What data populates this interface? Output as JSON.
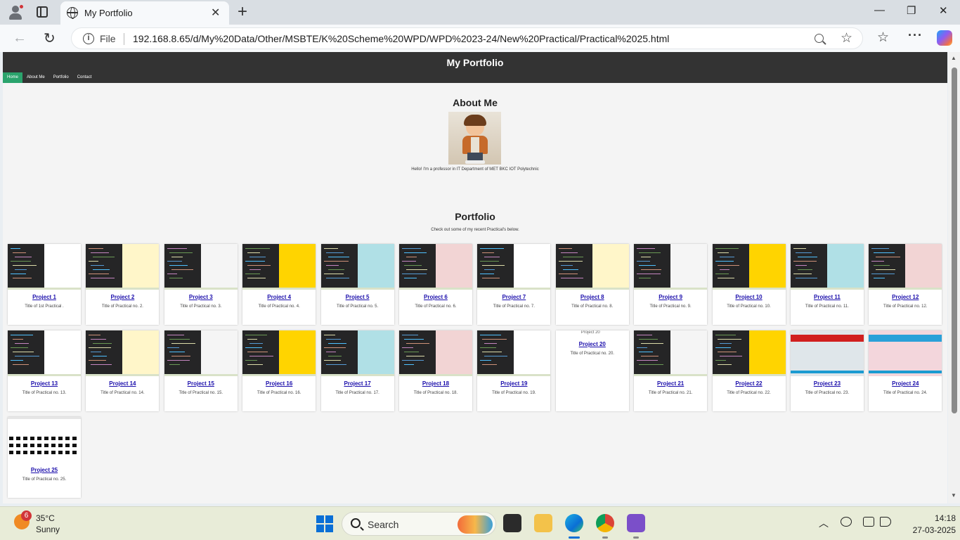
{
  "browser": {
    "tab_title": "My Portfolio",
    "file_label": "File",
    "url": "192.168.8.65/d/My%20Data/Other/MSBTE/K%20Scheme%20WPD/WPD%2023-24/New%20Practical/Practical%2025.html"
  },
  "page": {
    "site_title": "My Portfolio",
    "nav": [
      "Home",
      "About Me",
      "Portfolio",
      "Contact"
    ],
    "active_nav": "Home",
    "about": {
      "heading": "About Me",
      "text": "Hello! I'm a professor in IT Department of MET BKC IOT Polytechnic"
    },
    "portfolio": {
      "heading": "Portfolio",
      "subtitle": "Check out some of my recent Practical's below.",
      "projects": [
        {
          "title": "Project 1",
          "desc": "Title of 1st Practical ."
        },
        {
          "title": "Project 2",
          "desc": "Title of Practical no. 2."
        },
        {
          "title": "Project 3",
          "desc": "Title of Practical no. 3."
        },
        {
          "title": "Project 4",
          "desc": "Title of Practical no. 4."
        },
        {
          "title": "Project 5",
          "desc": "Title of Practical no. 5."
        },
        {
          "title": "Project 6",
          "desc": "Title of Practical no. 6."
        },
        {
          "title": "Project 7",
          "desc": "Title of Practical no. 7."
        },
        {
          "title": "Project 8",
          "desc": "Title of Practical no. 8."
        },
        {
          "title": "Project 9",
          "desc": "Title of Practical no. 9."
        },
        {
          "title": "Project 10",
          "desc": "Title of Practical no. 10."
        },
        {
          "title": "Project 11",
          "desc": "Title of Practical no. 11."
        },
        {
          "title": "Project 12",
          "desc": "Title of Practical no. 12."
        },
        {
          "title": "Project 13",
          "desc": "Title of Practical no. 13."
        },
        {
          "title": "Project 14",
          "desc": "Title of Practical no. 14."
        },
        {
          "title": "Project 15",
          "desc": "Title of Practical no. 15."
        },
        {
          "title": "Project 16",
          "desc": "Title of Practical no. 16."
        },
        {
          "title": "Project 17",
          "desc": "Title of Practical no. 17."
        },
        {
          "title": "Project 18",
          "desc": "Title of Practical no. 18."
        },
        {
          "title": "Project 19",
          "desc": "Title of Practical no. 19."
        },
        {
          "title": "Project 20",
          "desc": "Title of Practical no. 20.",
          "broken_image_alt": "Project 20"
        },
        {
          "title": "Project 21",
          "desc": "Title of Practical no. 21."
        },
        {
          "title": "Project 22",
          "desc": "Title of Practical no. 22."
        },
        {
          "title": "Project 23",
          "desc": "Title of Practical no. 23."
        },
        {
          "title": "Project 24",
          "desc": "Title of Practical no. 24."
        },
        {
          "title": "Project 25",
          "desc": "Title of Practical no. 25."
        }
      ]
    }
  },
  "taskbar": {
    "weather_badge": "6",
    "temperature": "35°C",
    "weather": "Sunny",
    "search_label": "Search",
    "time": "14:18",
    "date": "27-03-2025"
  },
  "colors": {
    "header_bg": "#333333",
    "nav_active": "#2aa36c",
    "link": "#1a0dab",
    "editor_bg": "#252526"
  }
}
